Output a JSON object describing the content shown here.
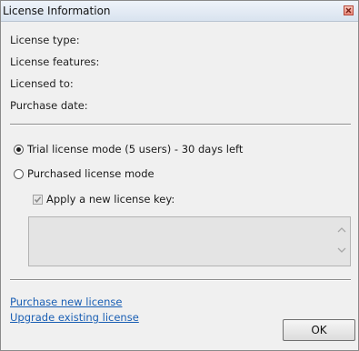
{
  "window": {
    "title": "License Information"
  },
  "info": {
    "license_type": "License type:",
    "license_features": "License features:",
    "licensed_to": "Licensed to:",
    "purchase_date": "Purchase date:"
  },
  "mode": {
    "trial_label": "Trial license mode (5 users) - 30 days left",
    "purchased_label": "Purchased license mode",
    "selected": "trial"
  },
  "apply_key": {
    "label": "Apply a new license key:",
    "checked": true,
    "enabled": false
  },
  "license_key_value": "",
  "links": {
    "purchase_new": "Purchase new license",
    "upgrade_existing": "Upgrade existing license"
  },
  "buttons": {
    "ok": "OK"
  },
  "icons": {
    "close": "close-icon",
    "check": "checkmark-icon",
    "scroll_up": "chevron-up-icon",
    "scroll_down": "chevron-down-icon"
  },
  "colors": {
    "link": "#1a5fb4",
    "close_button": "#e7887a"
  }
}
